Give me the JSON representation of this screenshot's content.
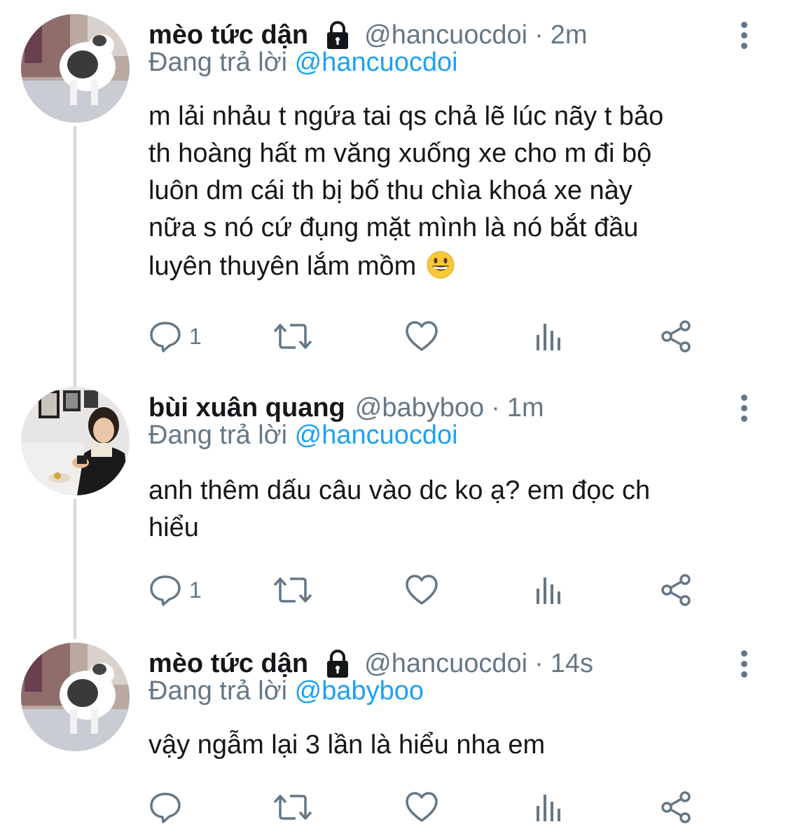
{
  "tweets": [
    {
      "name": "mèo tức dận",
      "locked": true,
      "handle": "@hancuocdoi",
      "separator": "·",
      "time": "2m",
      "replying_prefix": "Đang trả lời",
      "replying_to": "@hancuocdoi",
      "text_lines": [
        "m lải nhảu t ngứa tai qs chả lẽ lúc nãy t bảo",
        "th hoàng hất m văng xuống xe cho m đi bộ",
        "luôn dm cái th bị bố thu chìa khoá xe này",
        "nữa s nó cứ đụng mặt mình là nó bắt đầu",
        "luyên thuyên lắm mồm"
      ],
      "emoji": "grinning-face-emoji",
      "reply_count": "1"
    },
    {
      "name": "bùi xuân quang",
      "locked": false,
      "handle": "@babyboo",
      "separator": "·",
      "time": "1m",
      "replying_prefix": "Đang trả lời",
      "replying_to": "@hancuocdoi",
      "text_lines": [
        "anh thêm dấu câu vào dc ko ạ? em đọc ch",
        "hiểu"
      ],
      "reply_count": "1"
    },
    {
      "name": "mèo tức dận",
      "locked": true,
      "handle": "@hancuocdoi",
      "separator": "·",
      "time": "14s",
      "replying_prefix": "Đang trả lời",
      "replying_to": "@babyboo",
      "text_lines": [
        "vậy ngẫm lại 3 lần là hiểu nha em"
      ],
      "reply_count": ""
    }
  ],
  "icons": {
    "reply": "speech-bubble-icon",
    "retweet": "retweet-icon",
    "like": "heart-icon",
    "analytics": "bar-chart-icon",
    "share": "share-icon",
    "more": "vertical-ellipsis-icon",
    "lock": "lock-icon"
  },
  "colors": {
    "text": "#14171a",
    "secondary": "#657786",
    "link": "#1da1f2",
    "thread_line": "#cfd9de"
  }
}
